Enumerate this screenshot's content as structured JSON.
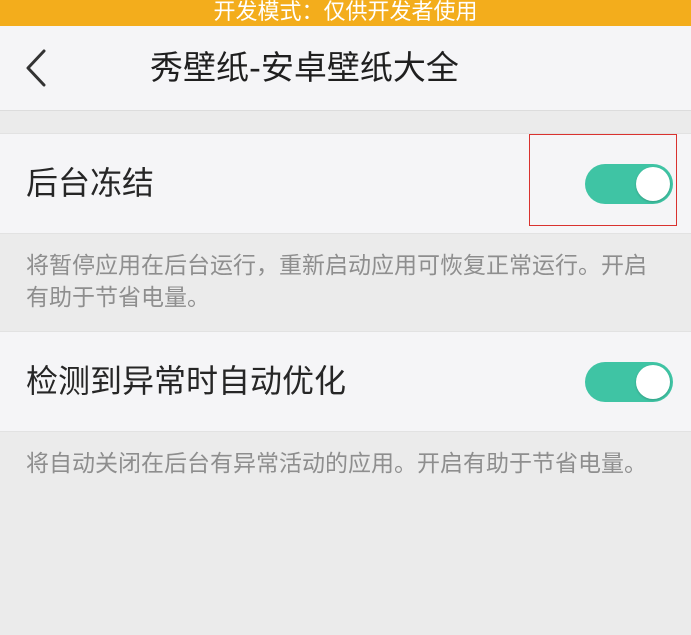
{
  "dev_banner": "开发模式：仅供开发者使用",
  "header": {
    "back_icon": "chevron-left-icon",
    "title": "秀壁纸-安卓壁纸大全"
  },
  "settings": [
    {
      "label": "后台冻结",
      "enabled": true,
      "description": "将暂停应用在后台运行，重新启动应用可恢复正常运行。开启有助于节省电量。"
    },
    {
      "label": "检测到异常时自动优化",
      "enabled": true,
      "description": "将自动关闭在后台有异常活动的应用。开启有助于节省电量。"
    }
  ],
  "colors": {
    "toggle_on": "#3fc4a4",
    "banner": "#f3ad1c",
    "highlight_box": "#d9322e"
  }
}
